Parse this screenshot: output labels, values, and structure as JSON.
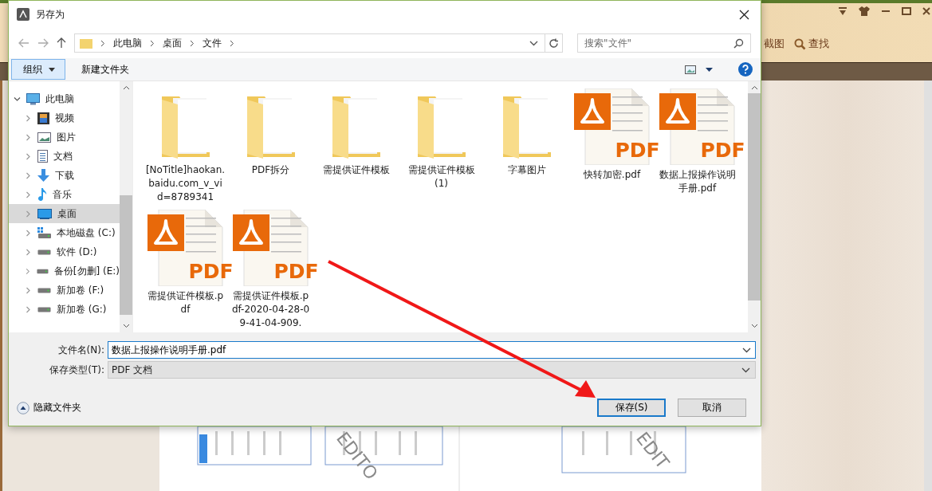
{
  "background_app": {
    "toolbar": [
      {
        "label": "截图",
        "kind": "plain"
      },
      {
        "label": "查找",
        "kind": "search"
      }
    ],
    "watermarks": [
      "EDITO",
      "EDIT"
    ]
  },
  "dialog": {
    "title": "另存为",
    "breadcrumb": [
      "此电脑",
      "桌面",
      "文件"
    ],
    "search": {
      "placeholder": "搜索\"文件\""
    },
    "toolbar": {
      "organize": "组织",
      "new_folder": "新建文件夹"
    },
    "nav": [
      {
        "label": "此电脑",
        "kind": "computer",
        "expanded": true,
        "selected": false,
        "children": [
          {
            "label": "视频",
            "kind": "video",
            "expanded": false,
            "selected": false
          },
          {
            "label": "图片",
            "kind": "pictures",
            "expanded": false,
            "selected": false
          },
          {
            "label": "文档",
            "kind": "documents",
            "expanded": false,
            "selected": false
          },
          {
            "label": "下载",
            "kind": "downloads",
            "expanded": false,
            "selected": false
          },
          {
            "label": "音乐",
            "kind": "music",
            "expanded": false,
            "selected": false
          },
          {
            "label": "桌面",
            "kind": "desktop",
            "expanded": false,
            "selected": true
          },
          {
            "label": "本地磁盘 (C:)",
            "kind": "system-drive",
            "expanded": false,
            "selected": false
          },
          {
            "label": "软件 (D:)",
            "kind": "drive",
            "expanded": false,
            "selected": false
          },
          {
            "label": "备份[勿删] (E:)",
            "kind": "drive",
            "expanded": false,
            "selected": false
          },
          {
            "label": "新加卷 (F:)",
            "kind": "drive",
            "expanded": false,
            "selected": false
          },
          {
            "label": "新加卷 (G:)",
            "kind": "drive",
            "expanded": false,
            "selected": false
          }
        ]
      }
    ],
    "files": [
      {
        "name": "[NoTitle]haokan.baidu.com_v_vid=8789341",
        "kind": "folder"
      },
      {
        "name": "PDF拆分",
        "kind": "folder"
      },
      {
        "name": "需提供证件模板",
        "kind": "folder"
      },
      {
        "name": "需提供证件模板 (1)",
        "kind": "folder"
      },
      {
        "name": "字幕图片",
        "kind": "folder"
      },
      {
        "name": "快转加密.pdf",
        "kind": "pdf",
        "badge": "PDF"
      },
      {
        "name": "数据上报操作说明手册.pdf",
        "kind": "pdf",
        "badge": "PDF"
      },
      {
        "name": "需提供证件模板.pdf",
        "kind": "pdf",
        "badge": "PDF"
      },
      {
        "name": "需提供证件模板.pdf-2020-04-28-09-41-04-909.",
        "kind": "pdf",
        "badge": "PDF"
      }
    ],
    "file_name": {
      "label": "文件名(N):",
      "value": "数据上报操作说明手册.pdf"
    },
    "save_type": {
      "label": "保存类型(T):",
      "value": "PDF 文档"
    },
    "hide_folders": "隐藏文件夹",
    "buttons": [
      {
        "label": "保存(S)",
        "default": true
      },
      {
        "label": "取消",
        "default": false
      }
    ]
  }
}
